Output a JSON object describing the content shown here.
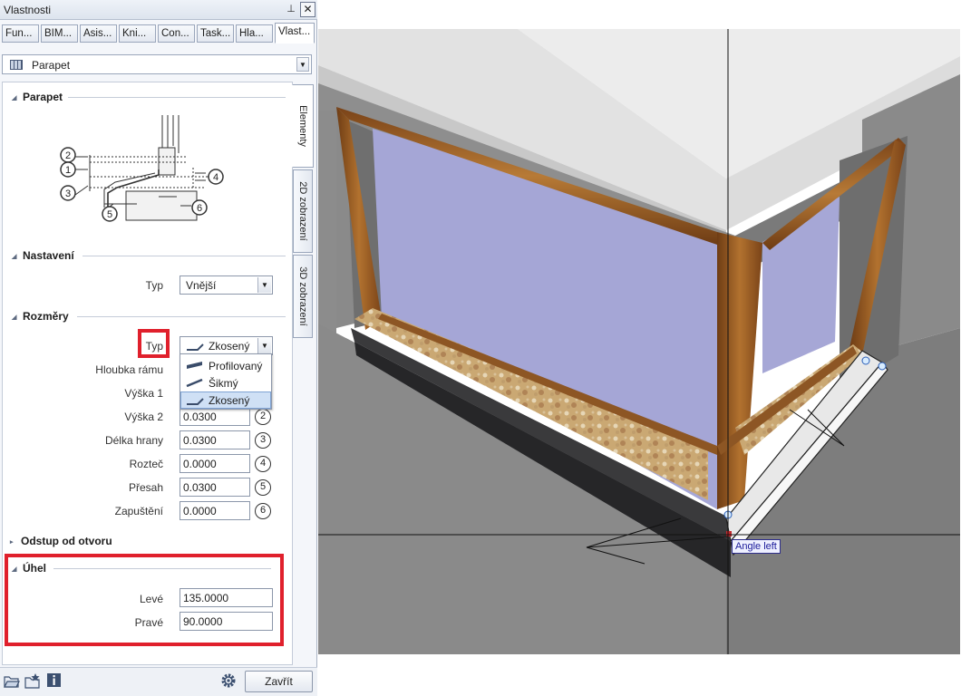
{
  "window": {
    "title": "Vlastnosti",
    "pin_glyph": "⊥",
    "close_glyph": "✕"
  },
  "tabs": [
    {
      "label": "Fun..."
    },
    {
      "label": "BIM..."
    },
    {
      "label": "Asis..."
    },
    {
      "label": "Kni..."
    },
    {
      "label": "Con..."
    },
    {
      "label": "Task..."
    },
    {
      "label": "Hla..."
    },
    {
      "label": "Vlast..."
    }
  ],
  "active_tab_index": 7,
  "selector": {
    "value": "Parapet",
    "icon": "wall-element-icon"
  },
  "side_tabs": [
    {
      "label": "Elementy"
    },
    {
      "label": "2D zobrazení"
    },
    {
      "label": "3D zobrazení"
    }
  ],
  "sections": {
    "parapet": {
      "title": "Parapet",
      "diagram_numbers": [
        "2",
        "1",
        "3",
        "4",
        "5",
        "6"
      ]
    },
    "nastaveni": {
      "title": "Nastavení",
      "typ_label": "Typ",
      "typ_value": "Vnější"
    },
    "rozmery": {
      "title": "Rozměry",
      "typ_label": "Typ",
      "typ_value": "Zkosený",
      "dropdown_options": [
        "Profilovaný",
        "Šikmý",
        "Zkosený"
      ],
      "selected_option": "Zkosený",
      "rows": [
        {
          "label": "Hloubka rámu",
          "value": "",
          "num": ""
        },
        {
          "label": "Výška 1",
          "value": "",
          "num": ""
        },
        {
          "label": "Výška 2",
          "value": "0.0300",
          "num": "2"
        },
        {
          "label": "Délka hrany",
          "value": "0.0300",
          "num": "3"
        },
        {
          "label": "Rozteč",
          "value": "0.0000",
          "num": "4"
        },
        {
          "label": "Přesah",
          "value": "0.0300",
          "num": "5"
        },
        {
          "label": "Zapuštění",
          "value": "0.0000",
          "num": "6"
        }
      ]
    },
    "odstup": {
      "title": "Odstup od otvoru"
    },
    "uhel": {
      "title": "Úhel",
      "rows": [
        {
          "label": "Levé",
          "value": "135.0000"
        },
        {
          "label": "Pravé",
          "value": "90.0000"
        }
      ]
    }
  },
  "bottom": {
    "close_label": "Zavřít",
    "icons": [
      "open-folder-icon",
      "favorites-icon",
      "info-icon",
      "settings-icon"
    ]
  },
  "viewport": {
    "tooltip": "Angle left"
  },
  "colors": {
    "highlight_red": "#e0202c",
    "selection_blue": "#cfe0f5",
    "glass": "#a4a4d4",
    "frame_wood": "#9a5a22",
    "sill_dark": "#2c2c2e"
  }
}
